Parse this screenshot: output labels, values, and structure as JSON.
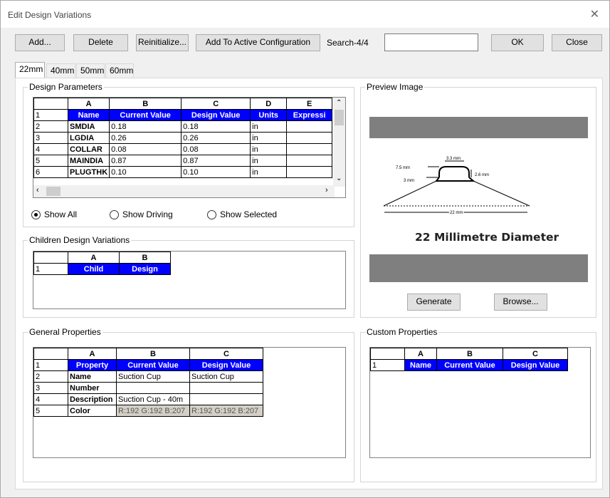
{
  "window": {
    "title": "Edit Design Variations"
  },
  "toolbar": {
    "add": "Add...",
    "delete": "Delete",
    "reinit": "Reinitialize...",
    "add_active": "Add To Active Configuration",
    "search_label": "Search-4/4",
    "ok": "OK",
    "close": "Close"
  },
  "tabs": [
    "22mm",
    "40mm",
    "50mm",
    "60mm"
  ],
  "design_params": {
    "label": "Design Parameters",
    "columns": [
      "A",
      "B",
      "C",
      "D",
      "E"
    ],
    "rows": [
      {
        "n": "1",
        "cells": [
          "Name",
          "Current Value",
          "Design Value",
          "Units",
          "Expressi"
        ]
      },
      {
        "n": "2",
        "cells": [
          "SMDIA",
          "0.18",
          "0.18",
          "in",
          ""
        ]
      },
      {
        "n": "3",
        "cells": [
          "LGDIA",
          "0.26",
          "0.26",
          "in",
          ""
        ]
      },
      {
        "n": "4",
        "cells": [
          "COLLAR",
          "0.08",
          "0.08",
          "in",
          ""
        ]
      },
      {
        "n": "5",
        "cells": [
          "MAINDIA",
          "0.87",
          "0.87",
          "in",
          ""
        ]
      },
      {
        "n": "6",
        "cells": [
          "PLUGTHK",
          "0.10",
          "0.10",
          "in",
          ""
        ]
      }
    ]
  },
  "filters": {
    "show_all": "Show All",
    "show_driving": "Show Driving",
    "show_selected": "Show Selected"
  },
  "children": {
    "label": "Children Design Variations",
    "columns": [
      "A",
      "B"
    ],
    "rows": [
      {
        "n": "1",
        "cells": [
          "Child",
          "Design"
        ]
      }
    ]
  },
  "preview": {
    "label": "Preview Image",
    "caption": "22 Millimetre Diameter",
    "dims": {
      "d1": "7.5 mm",
      "d2": "3.3 mm",
      "d3": "2.6 mm",
      "d4": "3 mm",
      "d5": "22 mm"
    },
    "generate": "Generate",
    "browse": "Browse..."
  },
  "general": {
    "label": "General Properties",
    "columns": [
      "A",
      "B",
      "C"
    ],
    "rows": [
      {
        "n": "1",
        "cells": [
          "Property",
          "Current Value",
          "Design Value"
        ]
      },
      {
        "n": "2",
        "cells": [
          "Name",
          "Suction Cup",
          "Suction Cup"
        ]
      },
      {
        "n": "3",
        "cells": [
          "Number",
          "",
          ""
        ]
      },
      {
        "n": "4",
        "cells": [
          "Description",
          "Suction Cup - 40m",
          ""
        ]
      },
      {
        "n": "5",
        "cells": [
          "Color",
          "R:192 G:192 B:207",
          "R:192 G:192 B:207"
        ]
      }
    ]
  },
  "custom": {
    "label": "Custom Properties",
    "columns": [
      "A",
      "B",
      "C"
    ],
    "rows": [
      {
        "n": "1",
        "cells": [
          "Name",
          "Current Value",
          "Design Value"
        ]
      }
    ]
  }
}
